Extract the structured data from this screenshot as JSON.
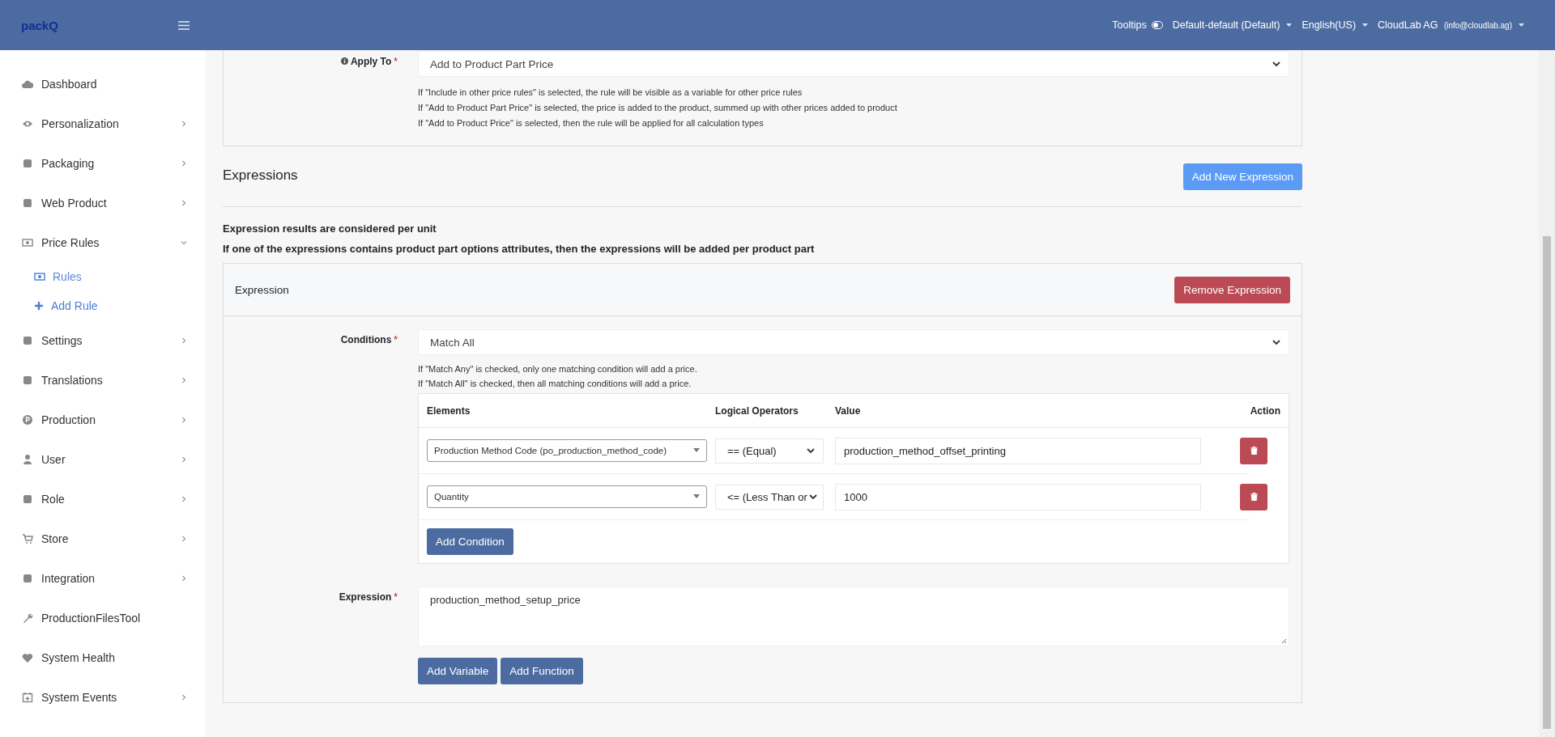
{
  "header": {
    "logo": "packQ",
    "tooltips": {
      "label": "Tooltips",
      "on": false
    },
    "menus": [
      {
        "label": "Default-default (Default)"
      },
      {
        "label": "English(US)"
      },
      {
        "label": "CloudLab AG",
        "note": "(info@cloudlab.ag)"
      }
    ]
  },
  "sidebar": {
    "items": [
      {
        "label": "Dashboard",
        "expandable": false
      },
      {
        "label": "Personalization",
        "expandable": true,
        "expanded": false
      },
      {
        "label": "Packaging",
        "expandable": true,
        "expanded": false
      },
      {
        "label": "Web Product",
        "expandable": true,
        "expanded": false
      },
      {
        "label": "Price Rules",
        "expandable": true,
        "expanded": true,
        "children": [
          {
            "label": "Rules",
            "selected": true
          },
          {
            "label": "Add Rule",
            "selected": false
          }
        ]
      },
      {
        "label": "Settings",
        "expandable": true,
        "expanded": false
      },
      {
        "label": "Translations",
        "expandable": true,
        "expanded": false
      },
      {
        "label": "Production",
        "expandable": true,
        "expanded": false
      },
      {
        "label": "User",
        "expandable": true,
        "expanded": false
      },
      {
        "label": "Role",
        "expandable": true,
        "expanded": false
      },
      {
        "label": "Store",
        "expandable": true,
        "expanded": false
      },
      {
        "label": "Integration",
        "expandable": true,
        "expanded": false
      },
      {
        "label": "ProductionFilesTool",
        "expandable": false
      },
      {
        "label": "System Health",
        "expandable": false
      },
      {
        "label": "System Events",
        "expandable": true,
        "expanded": false
      }
    ]
  },
  "apply_to": {
    "label": "Apply To",
    "required_mark": "*",
    "value": "Add to Product Part Price",
    "help": [
      "If \"Include in other price rules\" is selected, the rule will be visible as a variable for other price rules",
      "If \"Add to Product Part Price\" is selected, the price is added to the product, summed up with other prices added to product",
      "If \"Add to Product Price\" is selected, then the rule will be applied for all calculation types"
    ]
  },
  "expressions": {
    "title": "Expressions",
    "add_button": "Add New Expression",
    "notes": [
      "Expression results are considered per unit",
      "If one of the expressions contains product part options attributes, then the expressions will be added per product part"
    ],
    "card": {
      "title": "Expression",
      "remove_button": "Remove Expression",
      "conditions": {
        "label": "Conditions",
        "required_mark": "*",
        "value": "Match All",
        "help": [
          "If \"Match Any\" is checked, only one matching condition will add a price.",
          "If \"Match All\" is checked, then all matching conditions will add a price."
        ]
      },
      "table": {
        "columns": [
          "Elements",
          "Logical Operators",
          "Value",
          "Action"
        ],
        "rows": [
          {
            "element": "Production Method Code (po_production_method_code)",
            "operator": "== (Equal)",
            "value": "production_method_offset_printing"
          },
          {
            "element": "Quantity",
            "operator": "<= (Less Than or",
            "value": "1000"
          }
        ],
        "add_button": "Add Condition"
      },
      "expression": {
        "label": "Expression",
        "required_mark": "*",
        "value": "production_method_setup_price"
      },
      "buttons": [
        "Add Variable",
        "Add Function"
      ]
    }
  }
}
